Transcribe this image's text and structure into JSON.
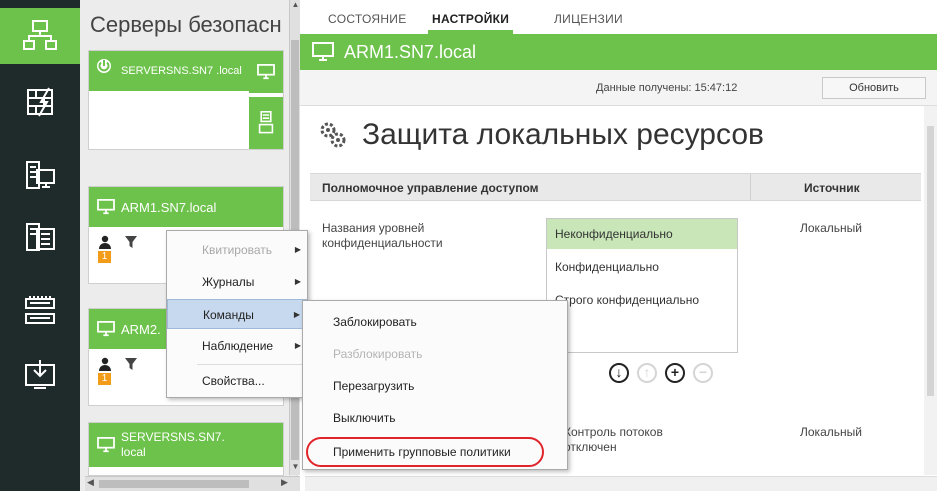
{
  "rail": {
    "icons": [
      "network-icon",
      "firewall-icon",
      "server-config-icon",
      "events-icon",
      "switch-icon",
      "download-icon"
    ]
  },
  "servers": {
    "title": "Серверы безопасн",
    "cards": [
      {
        "name": "SERVERSNS.SN7 .local",
        "status": "power-icon"
      },
      {
        "name": "ARM1.SN7.local"
      },
      {
        "name": "ARM2.",
        "badge": "1"
      },
      {
        "name": "SERVERSNS.SN7. local"
      }
    ],
    "arm1_badge": "1"
  },
  "tabs": [
    {
      "label": "СОСТОЯНИЕ",
      "active": false
    },
    {
      "label": "НАСТРОЙКИ",
      "active": true
    },
    {
      "label": "ЛИЦЕНЗИИ",
      "active": false
    }
  ],
  "header": {
    "title": "ARM1.SN7.local",
    "received_label": "Данные получены: 15:47:12",
    "refresh_label": "Обновить"
  },
  "page": {
    "title": "Защита локальных ресурсов",
    "table": {
      "col1": "Полномочное управление доступом",
      "col2": "Источник"
    },
    "row1": {
      "label": "Названия уровней конфиденциальности",
      "source": "Локальный",
      "levels": [
        "Неконфиденциально",
        "Конфиденциально",
        "Строго конфиденциально"
      ]
    },
    "row2": {
      "label": "Контроль потоков отключен",
      "source": "Локальный"
    }
  },
  "context_menu": {
    "items": [
      {
        "label": "Квитировать",
        "disabled": true,
        "submenu": true
      },
      {
        "label": "Журналы",
        "disabled": false,
        "submenu": true
      },
      {
        "label": "Команды",
        "disabled": false,
        "submenu": true,
        "highlighted": true
      },
      {
        "label": "Наблюдение",
        "disabled": false,
        "submenu": true
      },
      {
        "label": "Свойства...",
        "disabled": false,
        "submenu": false
      }
    ]
  },
  "submenu": {
    "items": [
      {
        "label": "Заблокировать",
        "disabled": false
      },
      {
        "label": "Разблокировать",
        "disabled": true
      },
      {
        "label": "Перезагрузить",
        "disabled": false
      },
      {
        "label": "Выключить",
        "disabled": false
      },
      {
        "label": "Применить групповые политики",
        "disabled": false,
        "circled": true
      }
    ]
  },
  "colors": {
    "accent": "#6cc24a",
    "rail": "#1f2a2a",
    "badge": "#f39c1a",
    "highlight": "#c7d9ee",
    "circle": "#e0242a"
  }
}
